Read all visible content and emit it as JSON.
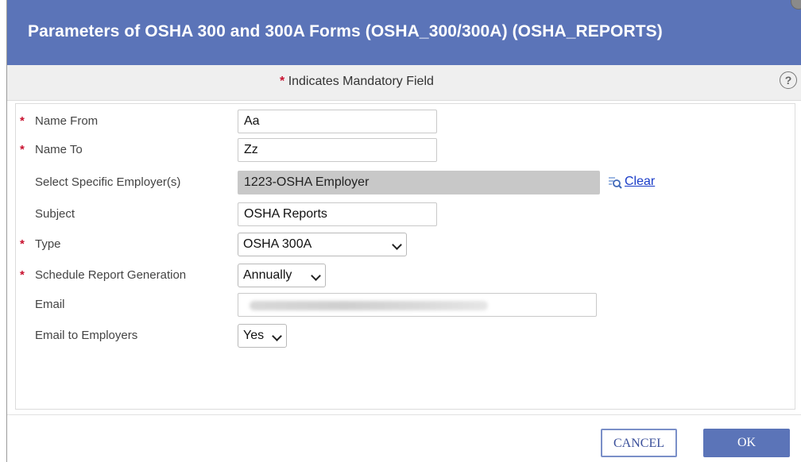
{
  "dialog": {
    "title": "Parameters of OSHA 300 and 300A Forms (OSHA_300/300A) (OSHA_REPORTS)",
    "mandatory_star": "*",
    "mandatory_text": "Indicates Mandatory Field",
    "help_icon": "?"
  },
  "form": {
    "name_from": {
      "label": "Name From",
      "required": "*",
      "value": "Aa"
    },
    "name_to": {
      "label": "Name To",
      "required": "*",
      "value": "Zz"
    },
    "employer": {
      "label": "Select Specific Employer(s)",
      "value": "1223-OSHA Employer",
      "clear_label": "Clear",
      "lookup_icon": "magnifier-list-icon"
    },
    "subject": {
      "label": "Subject",
      "value": "OSHA Reports"
    },
    "type": {
      "label": "Type",
      "required": "*",
      "selected": "OSHA 300A"
    },
    "schedule": {
      "label": "Schedule Report Generation",
      "required": "*",
      "selected": "Annually"
    },
    "email": {
      "label": "Email",
      "value": ""
    },
    "email_to_employers": {
      "label": "Email to Employers",
      "selected": "Yes"
    }
  },
  "buttons": {
    "cancel": "CANCEL",
    "ok": "OK"
  },
  "colors": {
    "header": "#5b74b8",
    "required_star": "#c8102e",
    "link": "#1a3cc8"
  }
}
